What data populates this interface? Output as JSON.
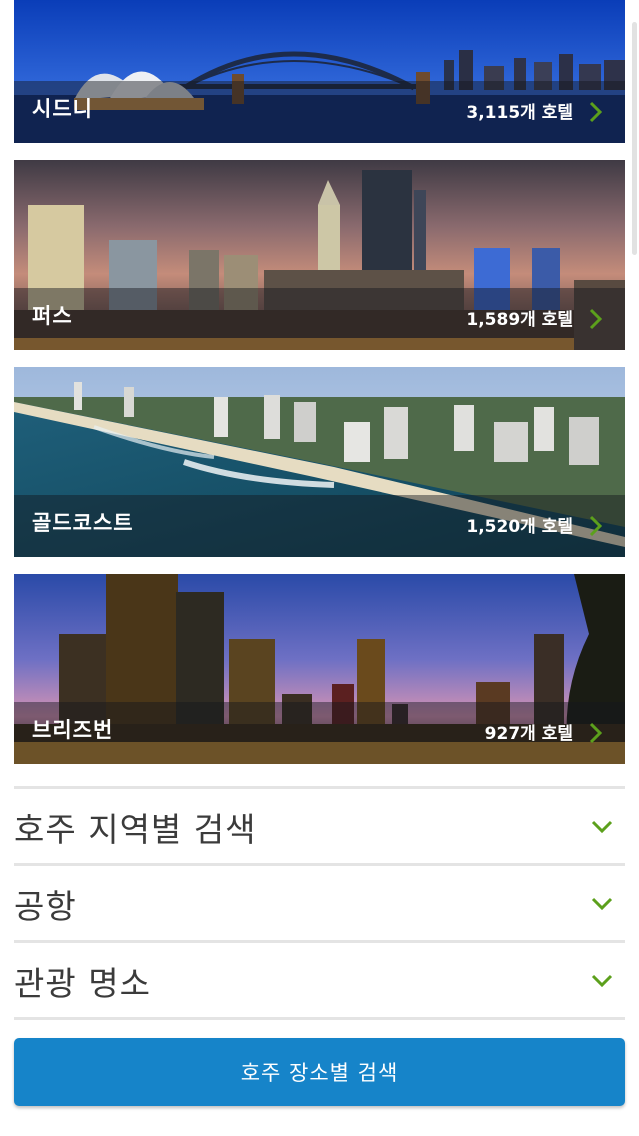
{
  "cities": [
    {
      "name": "시드니",
      "count": "3,115개 호텔"
    },
    {
      "name": "퍼스",
      "count": "1,589개 호텔"
    },
    {
      "name": "골드코스트",
      "count": "1,520개 호텔"
    },
    {
      "name": "브리즈번",
      "count": "927개 호텔"
    }
  ],
  "accordion": [
    {
      "label": "호주 지역별 검색"
    },
    {
      "label": "공항"
    },
    {
      "label": "관광 명소"
    }
  ],
  "search_button": {
    "label": "호주 장소별 검색"
  },
  "icons": {
    "card_arrow": "chevron-right-icon",
    "accordion_toggle": "chevron-down-icon"
  },
  "colors": {
    "accent_green": "#5ca01c",
    "button_blue": "#1684c9"
  }
}
